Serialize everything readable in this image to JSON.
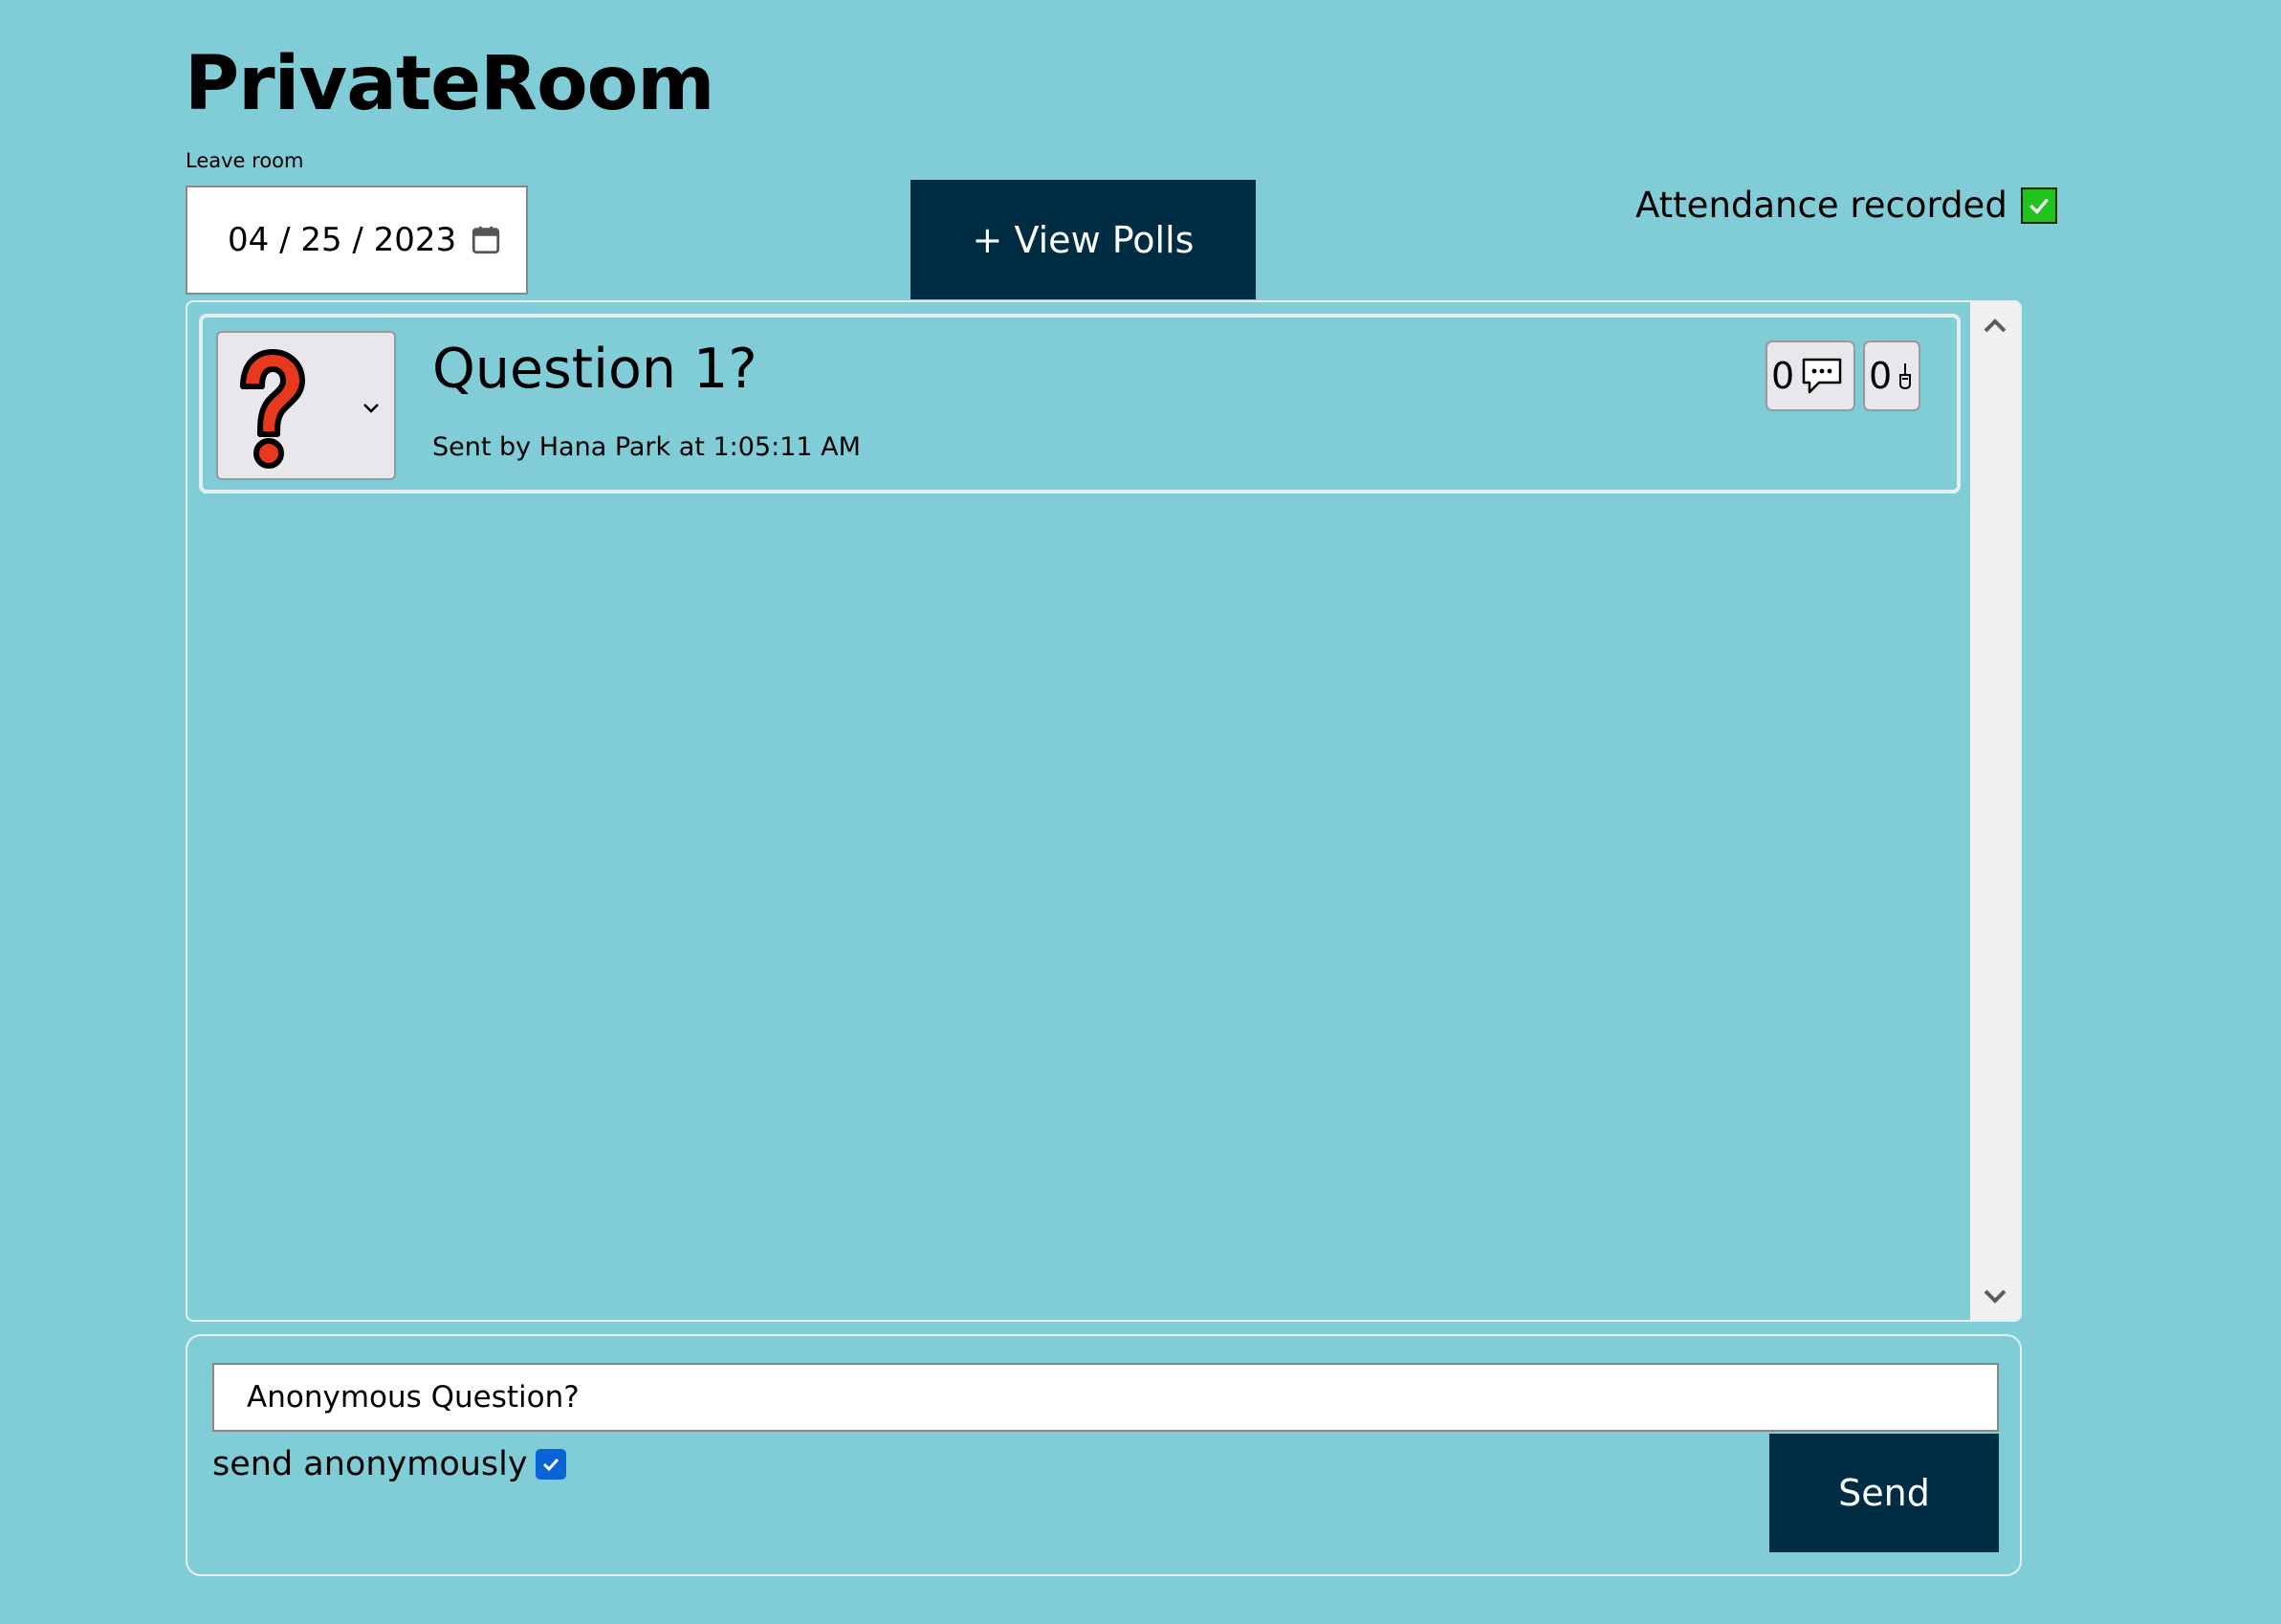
{
  "page": {
    "title": "PrivateRoom",
    "leave_room_label": "Leave room"
  },
  "date_input": {
    "value": "04 / 25 / 2023",
    "icon": "calendar-icon"
  },
  "view_polls": {
    "label": "+ View Polls"
  },
  "attendance": {
    "label": "Attendance recorded",
    "checked": true,
    "check_color": "#22c31f"
  },
  "feed": {
    "questions": [
      {
        "icon": "question-mark-icon",
        "text": "Question 1?",
        "meta": "Sent by Hana Park at 1:05:11 AM",
        "comment_count": "0",
        "upvote_count": "0"
      }
    ]
  },
  "compose": {
    "input_value": "Anonymous Question?",
    "anonymous_label": "send anonymously",
    "anonymous_checked": true,
    "send_label": "Send"
  },
  "colors": {
    "background": "#80cdd7",
    "button": "#002c44",
    "question_icon": "#e8391e"
  }
}
